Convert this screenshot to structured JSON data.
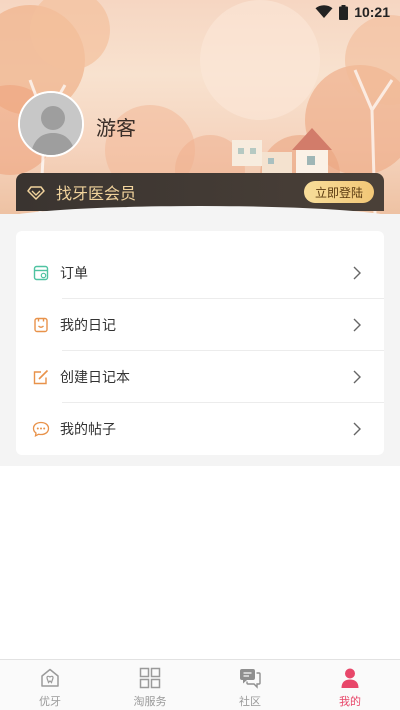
{
  "status_bar": {
    "time": "10:21"
  },
  "profile": {
    "username": "游客",
    "member_text": "找牙医会员",
    "login_button": "立即登陆"
  },
  "menu": [
    {
      "label": "订单",
      "icon": "order-icon",
      "color": "#4fc3a1"
    },
    {
      "label": "我的日记",
      "icon": "diary-icon",
      "color": "#e8924a"
    },
    {
      "label": "创建日记本",
      "icon": "edit-icon",
      "color": "#e8924a"
    },
    {
      "label": "我的帖子",
      "icon": "chat-bubble-icon",
      "color": "#e8924a"
    }
  ],
  "bottom_nav": [
    {
      "label": "优牙",
      "icon": "tooth-home-icon",
      "active": false
    },
    {
      "label": "淘服务",
      "icon": "grid-icon",
      "active": false
    },
    {
      "label": "社区",
      "icon": "community-chat-icon",
      "active": false
    },
    {
      "label": "我的",
      "icon": "person-icon",
      "active": true
    }
  ],
  "colors": {
    "accent": "#e8476a",
    "member_gold": "#f1d39c",
    "inactive_nav": "#9a9a9a"
  }
}
